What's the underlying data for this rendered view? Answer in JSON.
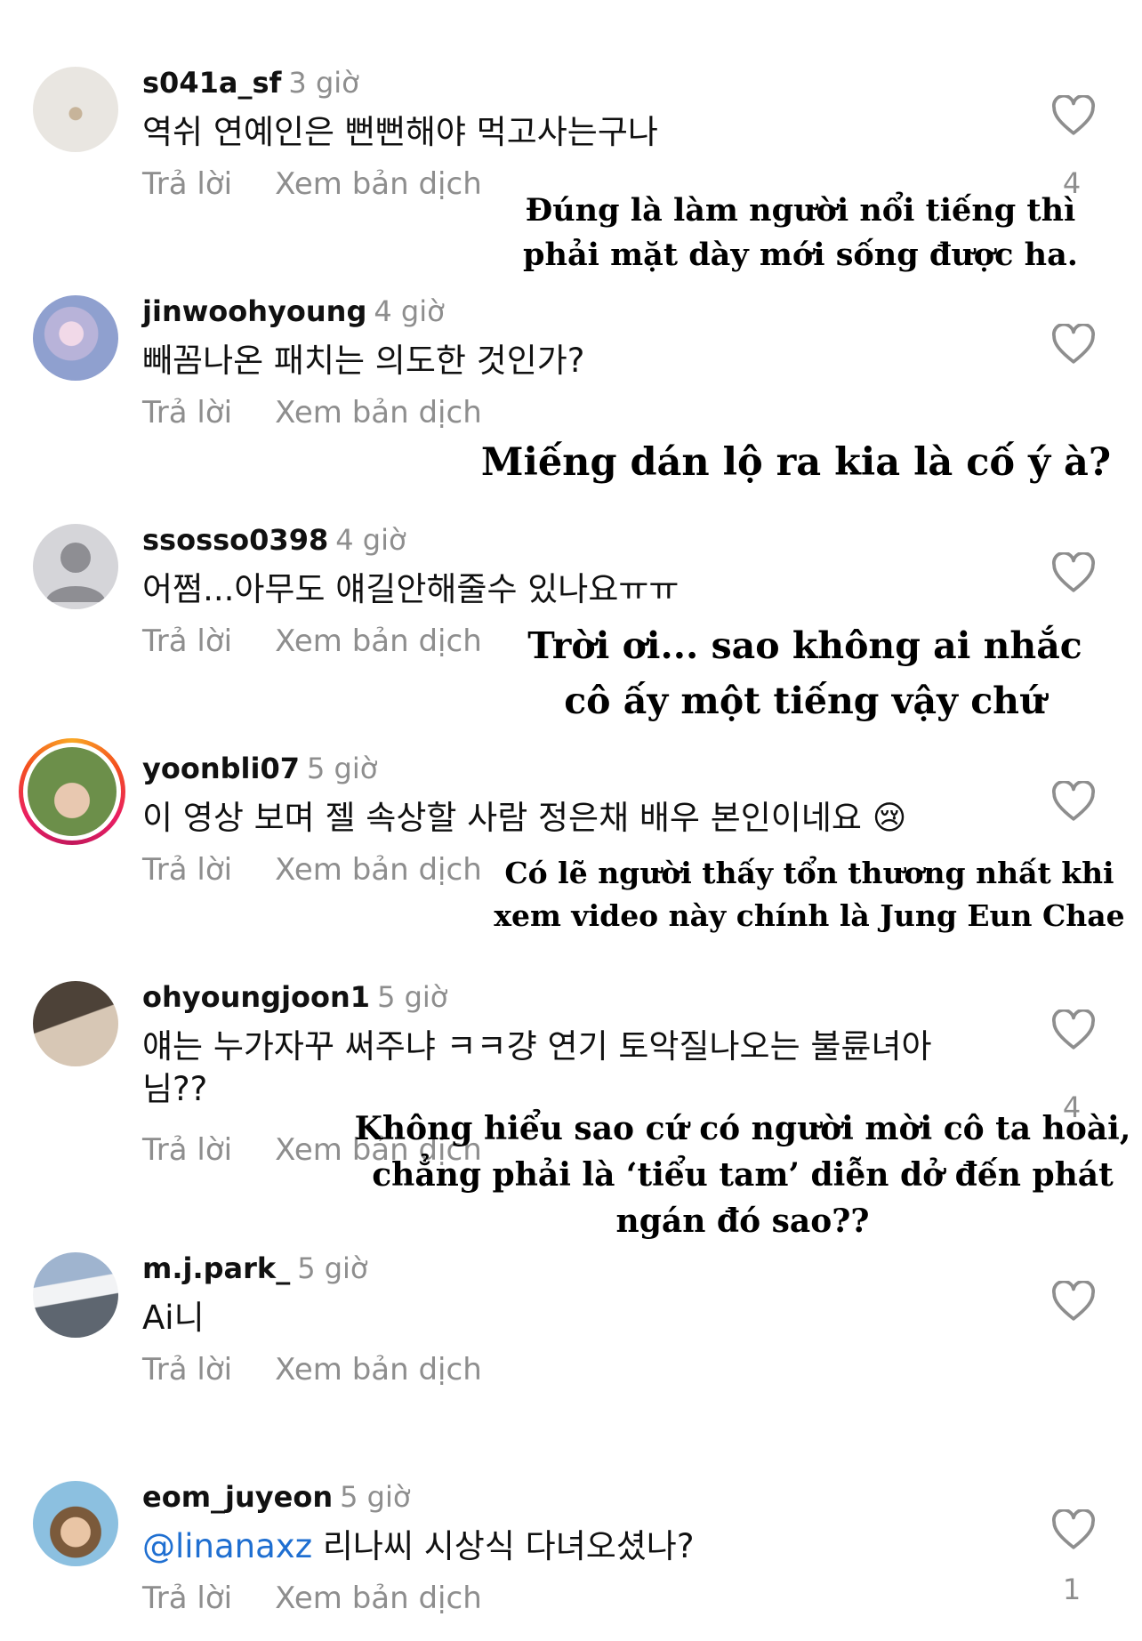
{
  "comments": [
    {
      "username": "s041a_sf",
      "time": "3 giờ",
      "text": "역쉬 연예인은 뻔뻔해야 먹고사는구나",
      "reply": "Trả lời",
      "translate": "Xem bản dịch",
      "likes": "4",
      "caption": "Đúng là làm người nổi tiếng thì phải mặt dày mới sống được ha."
    },
    {
      "username": "jinwoohyoung",
      "time": "4 giờ",
      "text": "빼꼼나온 패치는 의도한 것인가?",
      "reply": "Trả lời",
      "translate": "Xem bản dịch",
      "caption": "Miếng dán lộ ra kia là cố ý à?"
    },
    {
      "username": "ssosso0398",
      "time": "4 giờ",
      "text": "어쩜...아무도 얘길안해줄수 있나요ㅠㅠ",
      "reply": "Trả lời",
      "translate": "Xem bản dịch",
      "caption": "Trời ơi... sao không ai nhắc cô ấy một tiếng vậy chứ"
    },
    {
      "username": "yoonbli07",
      "time": "5 giờ",
      "text": "이 영상 보며 젤 속상할 사람 정은채 배우 본인이네요 😢",
      "reply": "Trả lời",
      "translate": "Xem bản dịch",
      "caption": "Có lẽ người thấy tổn thương nhất khi xem video này chính là Jung Eun Chae"
    },
    {
      "username": "ohyoungjoon1",
      "time": "5 giờ",
      "text": "얘는 누가자꾸 써주냐 ㅋㅋ걍 연기 토악질나오는 불륜녀아님??",
      "reply": "Trả lời",
      "translate": "Xem bản dịch",
      "likes": "4",
      "caption": "Không hiểu sao cứ có người mời cô ta hoài, chẳng phải là ‘tiểu tam’ diễn dở đến phát ngán đó sao??"
    },
    {
      "username": "m.j.park_",
      "time": "5 giờ",
      "text": "Ai니",
      "reply": "Trả lời",
      "translate": "Xem bản dịch"
    },
    {
      "username": "eom_juyeon",
      "time": "5 giờ",
      "mention": "@linanaxz",
      "text": " 리나씨 시상식 다녀오셨나?",
      "reply": "Trả lời",
      "translate": "Xem bản dịch",
      "likes": "1"
    }
  ],
  "colors": {
    "secondary_text": "#8e8e8e",
    "mention": "#1f6fd1",
    "story_ring": "#e91e63"
  }
}
